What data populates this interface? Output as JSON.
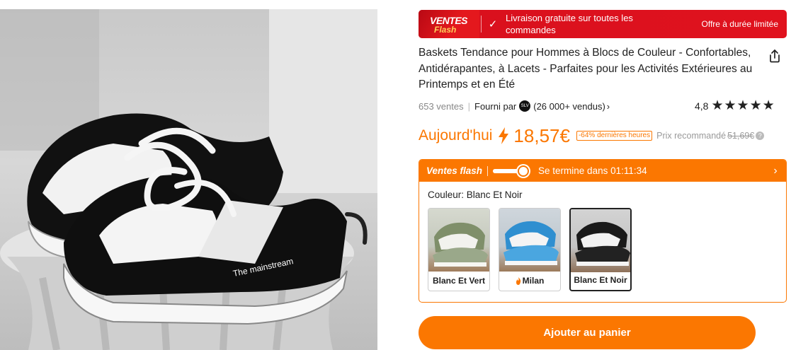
{
  "banner": {
    "logo_line1": "VENTES",
    "logo_line2": "Flash",
    "free_shipping": "Livraison gratuite sur toutes les commandes",
    "limited_offer": "Offre à durée limitée"
  },
  "product": {
    "title": "Baskets Tendance pour Hommes à Blocs de Couleur - Confortables, Antidérapantes, à Lacets - Parfaites pour les Activités Extérieures au Printemps et en Été",
    "image_alt": "Black and white sneaker",
    "sales": "653 ventes",
    "provided_by": "Fourni par",
    "store_logo": "SLV",
    "store_sold": "(26 000+ vendus)",
    "rating": "4,8",
    "stars": "★★★★★"
  },
  "price": {
    "today_label": "Aujourd'hui",
    "current": "18,57€",
    "discount_badge": "-64% dernières heures",
    "recommended_label": "Prix recommandé",
    "recommended_old": "51,69€",
    "info_icon": "?"
  },
  "flash_sale": {
    "label": "Ventes flash",
    "ends_in": "Se termine dans 01:11:34",
    "progress": 0.82
  },
  "color": {
    "label": "Couleur: Blanc Et Noir",
    "options": [
      {
        "name": "Blanc Et Vert",
        "selected": false
      },
      {
        "name": "Milan",
        "selected": false
      },
      {
        "name": "Blanc Et Noir",
        "selected": true
      }
    ]
  },
  "actions": {
    "add_to_cart": "Ajouter au panier"
  },
  "colors": {
    "accent": "#fb7701",
    "banner_red": "#e0121e"
  }
}
